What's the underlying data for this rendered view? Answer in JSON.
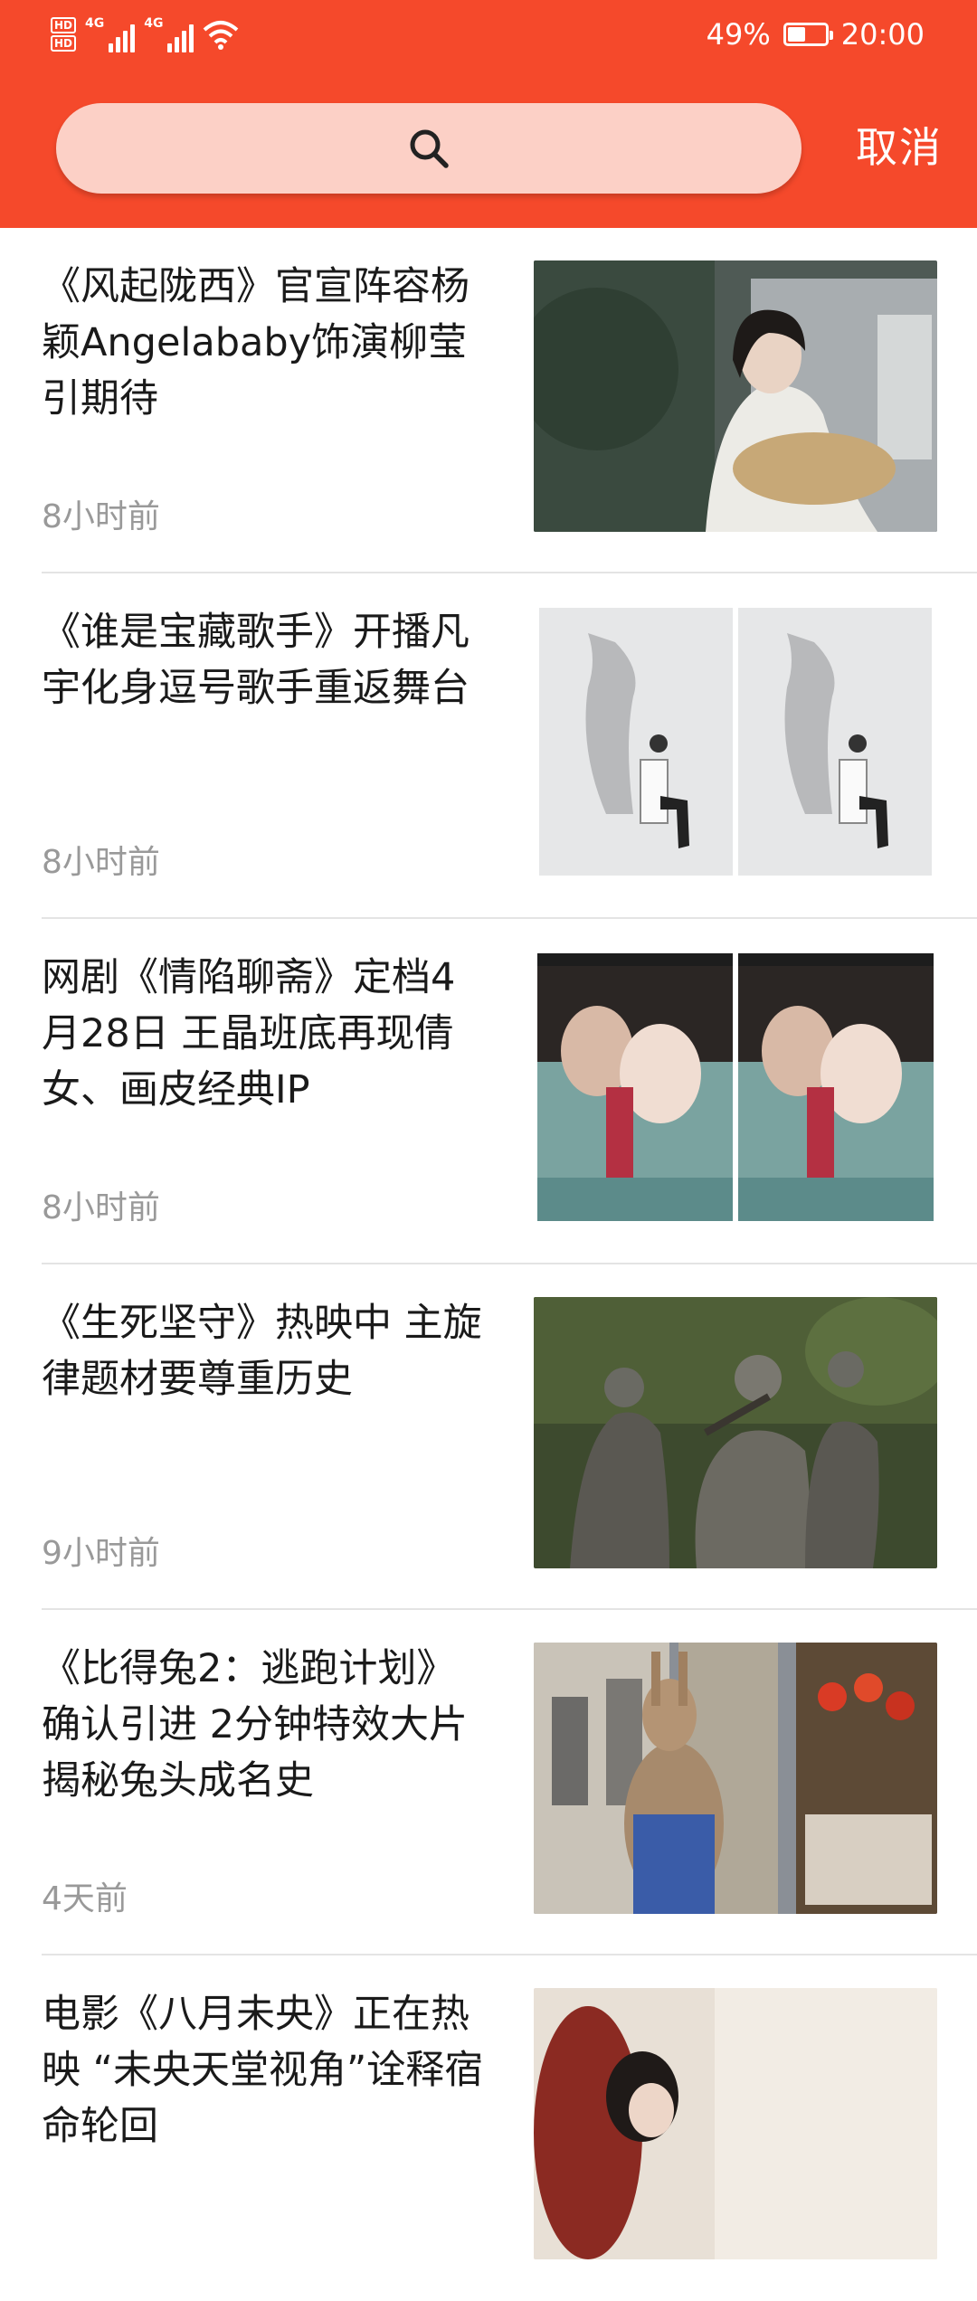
{
  "status_bar": {
    "hd_label": "HD",
    "network_1": "4G",
    "network_2": "4G",
    "battery_percent": "49%",
    "battery_level": 0.49,
    "time": "20:00"
  },
  "search": {
    "icon": "search-icon",
    "cancel_label": "取消"
  },
  "colors": {
    "header": "#f5492b",
    "search_field": "#fcd0c6",
    "timestamp": "#999999"
  },
  "news": [
    {
      "title": "《风起陇西》官宣阵容杨颖Angelababy饰演柳莹引期待",
      "time": "8小时前",
      "thumb": "woman-sitting-photo"
    },
    {
      "title": "《谁是宝藏歌手》开播凡宇化身逗号歌手重返舞台",
      "time": "8小时前",
      "thumb": "singer-poster-pair"
    },
    {
      "title": "网剧《情陷聊斋》定档4月28日 王晶班底再现倩女、画皮经典IP",
      "time": "8小时前",
      "thumb": "drama-poster-pair"
    },
    {
      "title": "《生死坚守》热映中 主旋律题材要尊重历史",
      "time": "9小时前",
      "thumb": "soldiers-still"
    },
    {
      "title": "《比得兔2：逃跑计划》确认引进 2分钟特效大片揭秘兔头成名史",
      "time": "4天前",
      "thumb": "rabbit-street-still"
    },
    {
      "title": "电影《八月未央》正在热映 “未央天堂视角”诠释宿命轮回",
      "time": "",
      "thumb": "film-still"
    }
  ]
}
